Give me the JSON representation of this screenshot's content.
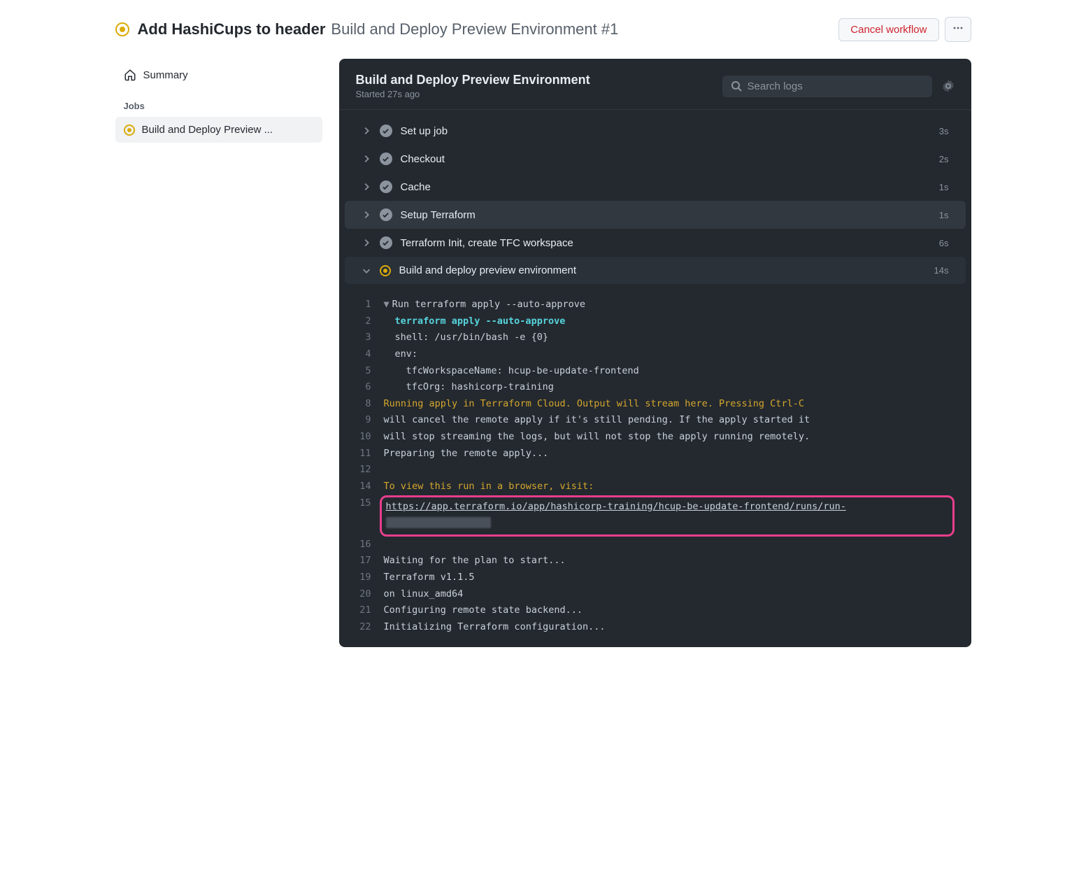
{
  "header": {
    "title_primary": "Add HashiCups to header",
    "title_secondary": "Build and Deploy Preview Environment #1",
    "cancel_label": "Cancel workflow"
  },
  "sidebar": {
    "summary_label": "Summary",
    "jobs_heading": "Jobs",
    "job_item_label": "Build and Deploy Preview ..."
  },
  "panel": {
    "title": "Build and Deploy Preview Environment",
    "subtitle": "Started 27s ago",
    "search_placeholder": "Search logs"
  },
  "steps": [
    {
      "name": "Set up job",
      "time": "3s",
      "status": "success",
      "expanded": false
    },
    {
      "name": "Checkout",
      "time": "2s",
      "status": "success",
      "expanded": false
    },
    {
      "name": "Cache",
      "time": "1s",
      "status": "success",
      "expanded": false
    },
    {
      "name": "Setup Terraform",
      "time": "1s",
      "status": "success",
      "expanded": false,
      "hovered": true
    },
    {
      "name": "Terraform Init, create TFC workspace",
      "time": "6s",
      "status": "success",
      "expanded": false
    },
    {
      "name": "Build and deploy preview environment",
      "time": "14s",
      "status": "running",
      "expanded": true
    }
  ],
  "log": {
    "lines": [
      {
        "n": "1",
        "kind": "group",
        "text": "Run terraform apply --auto-approve"
      },
      {
        "n": "2",
        "kind": "cmd",
        "text": "terraform apply --auto-approve"
      },
      {
        "n": "3",
        "kind": "plain-indent",
        "text": "shell: /usr/bin/bash -e {0}"
      },
      {
        "n": "4",
        "kind": "plain-indent",
        "text": "env:"
      },
      {
        "n": "5",
        "kind": "plain-indent2",
        "text": "tfcWorkspaceName: hcup-be-update-frontend"
      },
      {
        "n": "6",
        "kind": "plain-indent2",
        "text": "tfcOrg: hashicorp-training"
      },
      {
        "n": "8",
        "kind": "warn",
        "text": "Running apply in Terraform Cloud. Output will stream here. Pressing Ctrl-C"
      },
      {
        "n": "9",
        "kind": "plain",
        "text": "will cancel the remote apply if it's still pending. If the apply started it"
      },
      {
        "n": "10",
        "kind": "plain",
        "text": "will stop streaming the logs, but will not stop the apply running remotely."
      },
      {
        "n": "11",
        "kind": "plain",
        "text": "Preparing the remote apply..."
      },
      {
        "n": "12",
        "kind": "plain",
        "text": ""
      },
      {
        "n": "14",
        "kind": "warn",
        "text": "To view this run in a browser, visit:"
      },
      {
        "n": "15",
        "kind": "link",
        "text": "https://app.terraform.io/app/hashicorp-training/hcup-be-update-frontend/runs/run-",
        "highlight": true,
        "has_blur": true
      },
      {
        "n": "16",
        "kind": "plain",
        "text": ""
      },
      {
        "n": "17",
        "kind": "plain",
        "text": "Waiting for the plan to start..."
      },
      {
        "n": "19",
        "kind": "plain",
        "text": "Terraform v1.1.5"
      },
      {
        "n": "20",
        "kind": "plain",
        "text": "on linux_amd64"
      },
      {
        "n": "21",
        "kind": "plain",
        "text": "Configuring remote state backend..."
      },
      {
        "n": "22",
        "kind": "plain",
        "text": "Initializing Terraform configuration..."
      }
    ]
  }
}
